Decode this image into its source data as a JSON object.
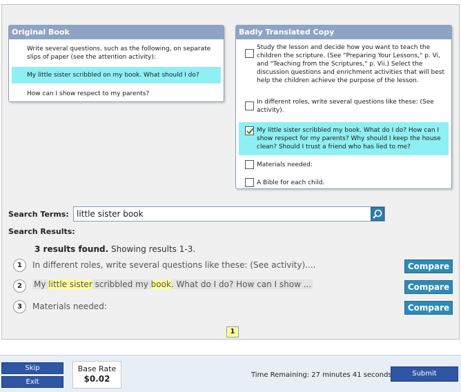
{
  "original_book": {
    "title": "Original Book",
    "items": [
      "Write several questions, such as the following, on separate slips of paper (see the attention activity):",
      "My little sister scribbled on my book. What should I do?",
      "How can I show respect to my parents?"
    ]
  },
  "translated_copy": {
    "title": "Badly Translated Copy",
    "items": [
      {
        "text": "Study the lesson and decide how you want to teach the children the scripture. (See \"Preparing Your Lessons,\" p. Vi, and \"Teaching from the Scriptures,\" p. Vii.) Select the discussion questions and enrichment activities that will best help the children achieve the purpose of the lesson.",
        "checked": false
      },
      {
        "text": "In different roles, write several questions like these: (See activity).",
        "checked": false
      },
      {
        "text": "My little sister scribbled my book. What do I do? How can I show respect for my parents? Why should I keep the house clean? Should I trust a friend who has lied to me?",
        "checked": true
      },
      {
        "text": "Materials needed:",
        "checked": false
      },
      {
        "text": "A Bible for each child.",
        "checked": false
      }
    ]
  },
  "search": {
    "label": "Search Terms:",
    "value": "little sister book",
    "results_label": "Search Results:",
    "found_count": "3 results found.",
    "showing": "Showing results 1-3."
  },
  "results": [
    {
      "num": "1",
      "text": "In different roles, write several questions like these: (See activity)...."
    },
    {
      "num": "2",
      "parts": [
        "My ",
        "little sister",
        " scribbled my ",
        "book",
        ". What do I do? How can I show ..."
      ]
    },
    {
      "num": "3",
      "text": "Materials needed:"
    }
  ],
  "compare_label": "Compare",
  "page_number": "1",
  "footer": {
    "skip": "Skip",
    "exit": "Exit",
    "base_rate_label": "Base Rate",
    "base_rate_value": "$0.02",
    "time_remaining": "Time Remaining: 27 minutes 41 seconds",
    "submit": "Submit"
  },
  "colors": {
    "panel_header": "#8fa4c4",
    "highlight": "#8ff0f4",
    "compare_button": "#2f8bb5",
    "footer_button": "#2e56a4",
    "keyword_highlight": "#ffff99"
  }
}
